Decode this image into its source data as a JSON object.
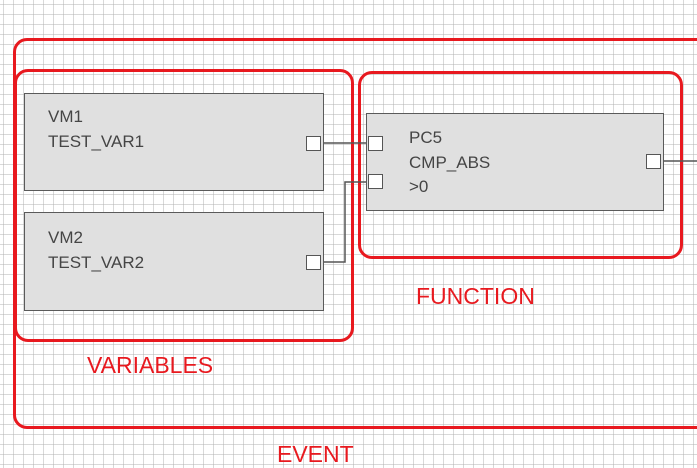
{
  "colors": {
    "group_outline": "#e8191f",
    "group_label": "#e8191f",
    "block_fill": "#e0e0e0",
    "block_border": "#5a5a5a",
    "block_text": "#454545",
    "wire": "#555555"
  },
  "groups": {
    "event": {
      "label": "EVENT"
    },
    "variables": {
      "label": "VARIABLES"
    },
    "function": {
      "label": "FUNCTION"
    }
  },
  "blocks": {
    "vm1": {
      "id": "VM1",
      "variable": "TEST_VAR1"
    },
    "vm2": {
      "id": "VM2",
      "variable": "TEST_VAR2"
    },
    "pc5": {
      "id": "PC5",
      "operation": "CMP_ABS",
      "condition": ">0"
    }
  },
  "connections": [
    {
      "from": "VM1.out",
      "to": "PC5.in1"
    },
    {
      "from": "VM2.out",
      "to": "PC5.in2"
    },
    {
      "from": "PC5.out",
      "to": "off-screen"
    }
  ]
}
